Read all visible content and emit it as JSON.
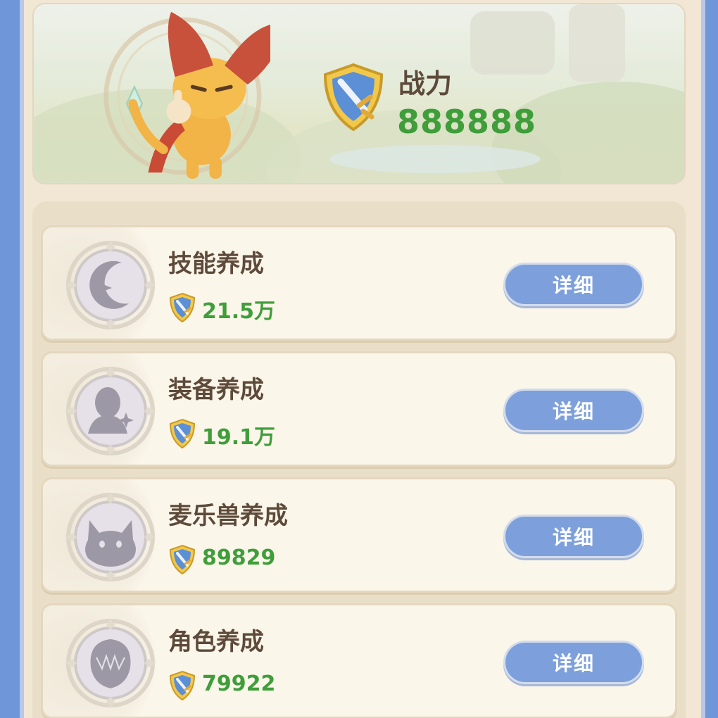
{
  "power": {
    "label": "战力",
    "value": "888888"
  },
  "items": [
    {
      "title": "技能养成",
      "value": "21.5万",
      "button": "详细",
      "icon": "moon-star-icon"
    },
    {
      "title": "装备养成",
      "value": "19.1万",
      "button": "详细",
      "icon": "equipment-figure-icon"
    },
    {
      "title": "麦乐兽养成",
      "value": "89829",
      "button": "详细",
      "icon": "cat-head-icon"
    },
    {
      "title": "角色养成",
      "value": "79922",
      "button": "详细",
      "icon": "hero-head-icon"
    }
  ],
  "colors": {
    "accent_green": "#3f9e3a",
    "button_blue": "#7da0dc",
    "text_brown": "#5e4a3a"
  }
}
